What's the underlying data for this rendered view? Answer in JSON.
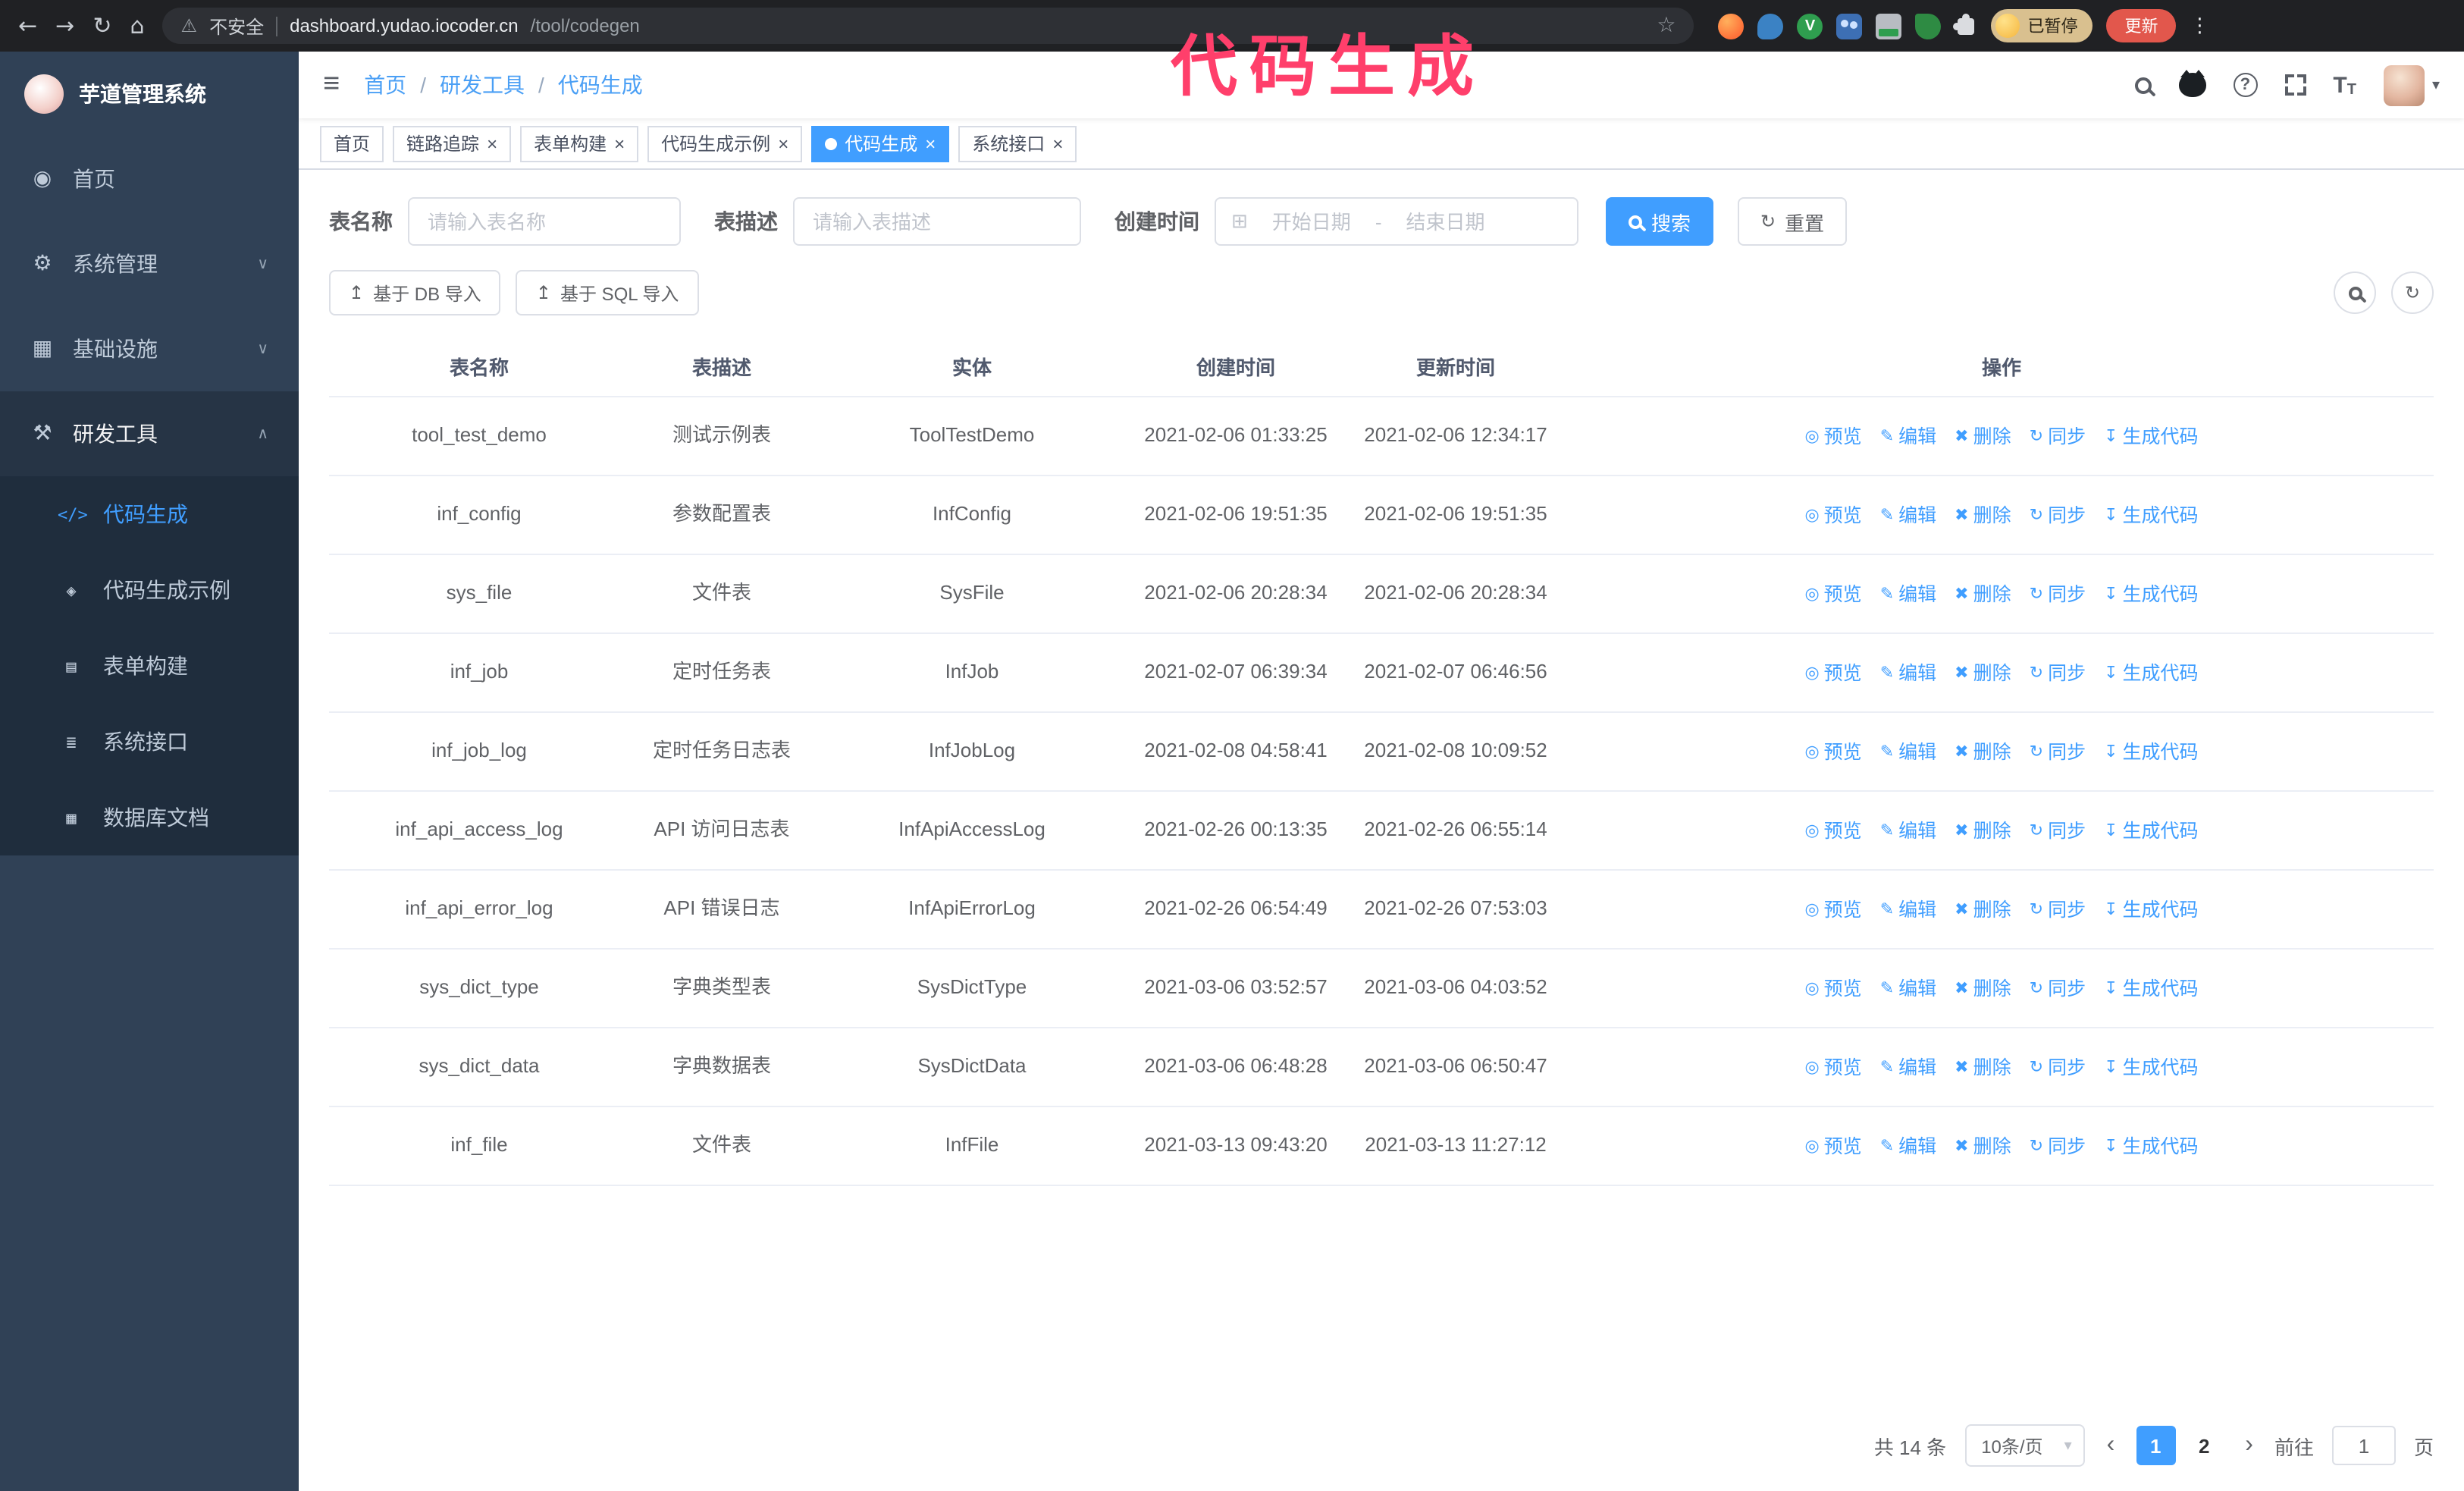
{
  "browser": {
    "security_label": "不安全",
    "url_domain": "dashboard.yudao.iocoder.cn",
    "url_path": "/tool/codegen",
    "paused_badge": "已暂停",
    "update_button": "更新"
  },
  "annotation": "代码生成",
  "icons": {
    "back": "←",
    "forward": "→",
    "reload": "↻",
    "home": "⌂",
    "warning": "⚠",
    "star": "☆",
    "kebab": "⋮",
    "hamburger": "≡",
    "caret_down": "▾",
    "crumb_sep": "/",
    "close": "×",
    "calendar": "⊞",
    "reset": "↻",
    "upload": "↥",
    "refresh": "↻",
    "question": "?"
  },
  "sidebar": {
    "logo_title": "芋道管理系统",
    "items": [
      {
        "key": "home",
        "label": "首页",
        "icon": "◉",
        "chevron": ""
      },
      {
        "key": "system",
        "label": "系统管理",
        "icon": "⚙",
        "chevron": "∨"
      },
      {
        "key": "infra",
        "label": "基础设施",
        "icon": "▦",
        "chevron": "∨"
      },
      {
        "key": "devtools",
        "label": "研发工具",
        "icon": "⚒",
        "chevron": "∧",
        "expanded": true
      }
    ],
    "submenu": [
      {
        "key": "codegen",
        "label": "代码生成",
        "icon": "</>",
        "active": true
      },
      {
        "key": "codegen-example",
        "label": "代码生成示例",
        "icon": "◈"
      },
      {
        "key": "form-build",
        "label": "表单构建",
        "icon": "▤"
      },
      {
        "key": "api",
        "label": "系统接口",
        "icon": "≣"
      },
      {
        "key": "db-doc",
        "label": "数据库文档",
        "icon": "▦"
      }
    ]
  },
  "breadcrumb": [
    "首页",
    "研发工具",
    "代码生成"
  ],
  "tabs": [
    {
      "key": "home",
      "label": "首页",
      "closable": false,
      "active": false
    },
    {
      "key": "trace",
      "label": "链路追踪",
      "closable": true,
      "active": false
    },
    {
      "key": "form-build",
      "label": "表单构建",
      "closable": true,
      "active": false
    },
    {
      "key": "codegen-example",
      "label": "代码生成示例",
      "closable": true,
      "active": false
    },
    {
      "key": "codegen",
      "label": "代码生成",
      "closable": true,
      "active": true
    },
    {
      "key": "api",
      "label": "系统接口",
      "closable": true,
      "active": false
    }
  ],
  "filters": {
    "table_name_label": "表名称",
    "table_name_placeholder": "请输入表名称",
    "table_desc_label": "表描述",
    "table_desc_placeholder": "请输入表描述",
    "create_time_label": "创建时间",
    "date_start_placeholder": "开始日期",
    "date_sep": "-",
    "date_end_placeholder": "结束日期",
    "search_button": "搜索",
    "reset_button": "重置"
  },
  "toolbar": {
    "import_db": "基于 DB 导入",
    "import_sql": "基于 SQL 导入"
  },
  "table": {
    "columns": [
      "表名称",
      "表描述",
      "实体",
      "创建时间",
      "更新时间",
      "操作"
    ],
    "actions": [
      {
        "key": "preview",
        "glyph": "◎",
        "label": "预览"
      },
      {
        "key": "edit",
        "glyph": "✎",
        "label": "编辑"
      },
      {
        "key": "delete",
        "glyph": "✖",
        "label": "删除"
      },
      {
        "key": "sync",
        "glyph": "↻",
        "label": "同步"
      },
      {
        "key": "generate",
        "glyph": "↧",
        "label": "生成代码"
      }
    ],
    "rows": [
      {
        "name": "tool_test_demo",
        "desc": "测试示例表",
        "entity": "ToolTestDemo",
        "created": "2021-02-06 01:33:25",
        "updated": "2021-02-06 12:34:17"
      },
      {
        "name": "inf_config",
        "desc": "参数配置表",
        "entity": "InfConfig",
        "created": "2021-02-06 19:51:35",
        "updated": "2021-02-06 19:51:35"
      },
      {
        "name": "sys_file",
        "desc": "文件表",
        "entity": "SysFile",
        "created": "2021-02-06 20:28:34",
        "updated": "2021-02-06 20:28:34"
      },
      {
        "name": "inf_job",
        "desc": "定时任务表",
        "entity": "InfJob",
        "created": "2021-02-07 06:39:34",
        "updated": "2021-02-07 06:46:56"
      },
      {
        "name": "inf_job_log",
        "desc": "定时任务日志表",
        "entity": "InfJobLog",
        "created": "2021-02-08 04:58:41",
        "updated": "2021-02-08 10:09:52"
      },
      {
        "name": "inf_api_access_log",
        "desc": "API 访问日志表",
        "entity": "InfApiAccessLog",
        "created": "2021-02-26 00:13:35",
        "updated": "2021-02-26 06:55:14"
      },
      {
        "name": "inf_api_error_log",
        "desc": "API 错误日志",
        "entity": "InfApiErrorLog",
        "created": "2021-02-26 06:54:49",
        "updated": "2021-02-26 07:53:03"
      },
      {
        "name": "sys_dict_type",
        "desc": "字典类型表",
        "entity": "SysDictType",
        "created": "2021-03-06 03:52:57",
        "updated": "2021-03-06 04:03:52"
      },
      {
        "name": "sys_dict_data",
        "desc": "字典数据表",
        "entity": "SysDictData",
        "created": "2021-03-06 06:48:28",
        "updated": "2021-03-06 06:50:47"
      },
      {
        "name": "inf_file",
        "desc": "文件表",
        "entity": "InfFile",
        "created": "2021-03-13 09:43:20",
        "updated": "2021-03-13 11:27:12"
      }
    ]
  },
  "pagination": {
    "total": "共 14 条",
    "page_size": "10条/页",
    "pages": [
      {
        "label": "1",
        "active": true
      },
      {
        "label": "2",
        "active": false
      }
    ],
    "prev": "‹",
    "next": "›",
    "goto_label": "前往",
    "goto_value": "1",
    "goto_suffix": "页"
  },
  "colors": {
    "accent": "#409eff",
    "sidebar_bg": "#304156",
    "submenu_bg": "#1f2d3d",
    "annotation": "#ff3f6b"
  }
}
